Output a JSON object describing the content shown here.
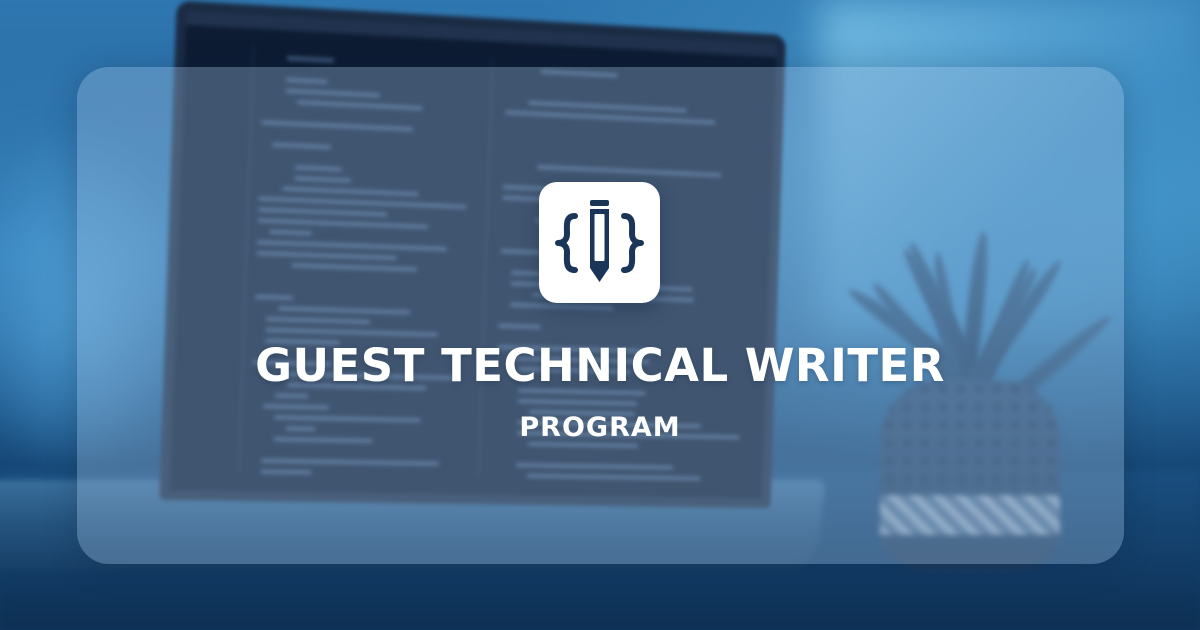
{
  "banner": {
    "title": "GUEST TECHNICAL WRITER",
    "subtitle": "PROGRAM"
  },
  "logo": {
    "icon": "code-braces-pencil-icon",
    "color": "#1b3558",
    "tile_color": "#ffffff"
  },
  "colors": {
    "overlay": "#9bbcde",
    "text": "#ffffff",
    "background": "#1f5c94"
  }
}
